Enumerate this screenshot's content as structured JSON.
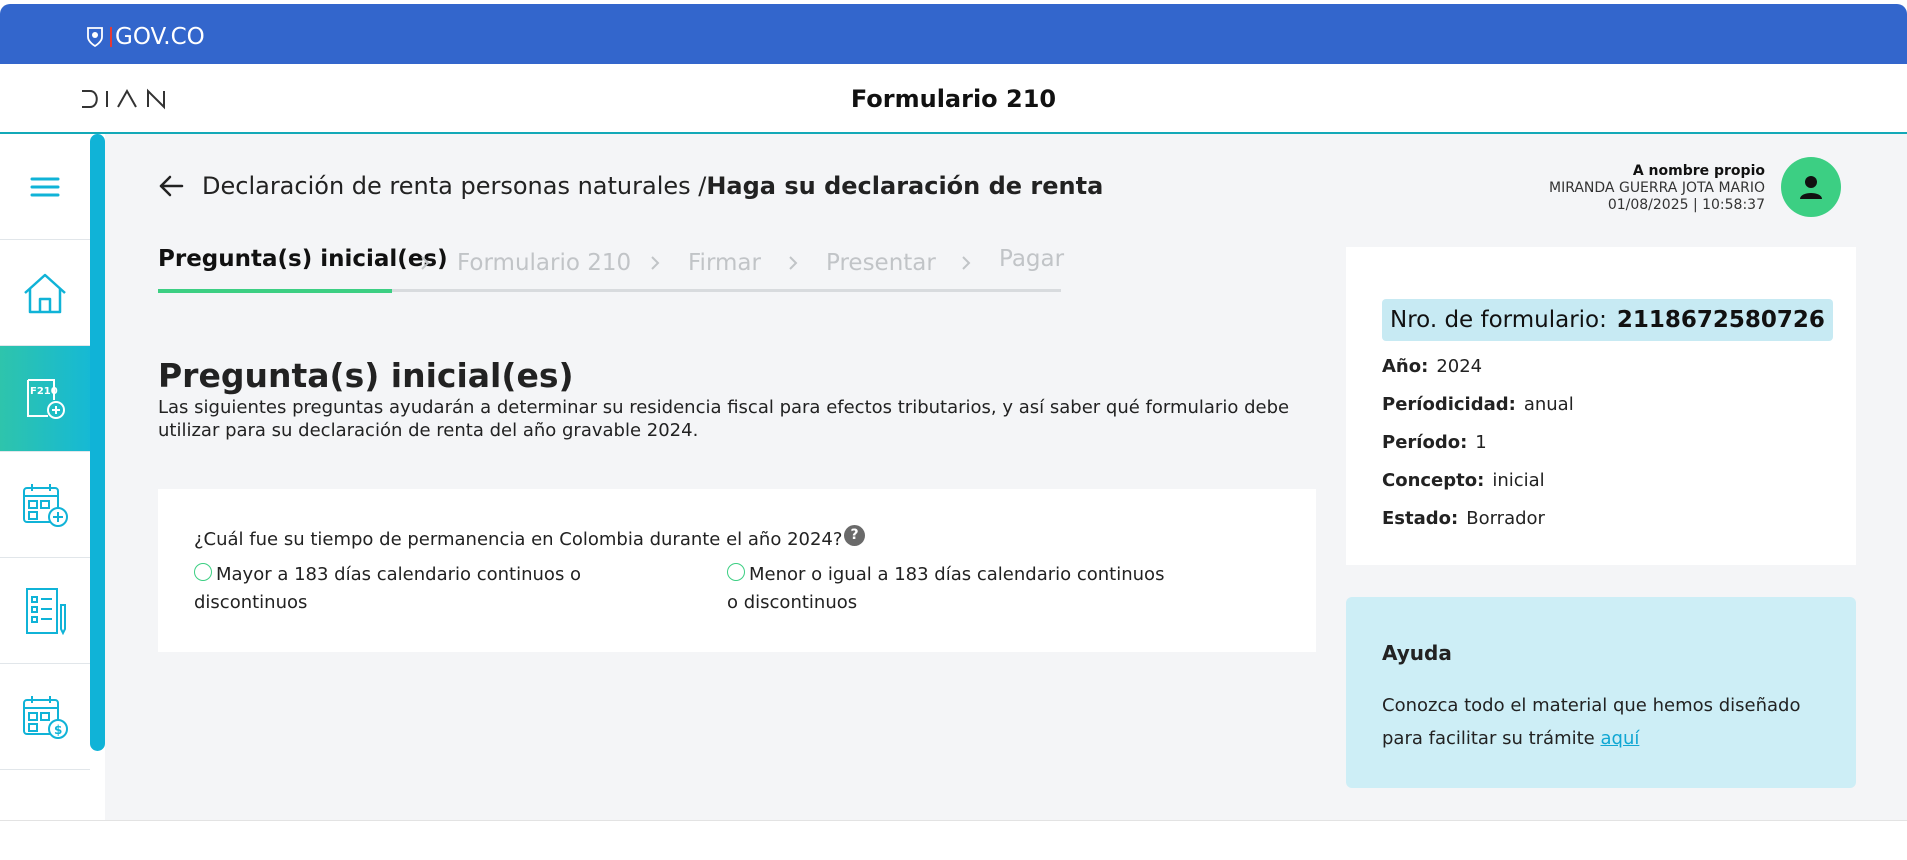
{
  "gov": {
    "label": "GOV.CO"
  },
  "header": {
    "logo_text": "DIAN",
    "title": "Formulario 210"
  },
  "sidebar": {
    "items": [
      {
        "icon": "menu-icon"
      },
      {
        "icon": "home-icon"
      },
      {
        "icon": "form-f210-add-icon",
        "icon_text": "F210",
        "active": true
      },
      {
        "icon": "calendar-add-icon"
      },
      {
        "icon": "checklist-icon"
      },
      {
        "icon": "calendar-payment-icon"
      }
    ],
    "colors": {
      "accent": "#10b3d7",
      "active_from": "#2ec4ac",
      "active_to": "#16b9d4"
    }
  },
  "breadcrumb": {
    "parent": "Declaración de renta personas naturales / ",
    "current": "Haga su declaración de renta"
  },
  "user": {
    "mode": "A nombre propio",
    "name": "MIRANDA GUERRA JOTA MARIO",
    "datetime": "01/08/2025 | 10:58:37"
  },
  "steps": [
    {
      "label": "Pregunta(s) inicial(es)",
      "active": true
    },
    {
      "label": "Formulario 210",
      "active": false
    },
    {
      "label": "Firmar",
      "active": false
    },
    {
      "label": "Presentar",
      "active": false
    },
    {
      "label": "Pagar",
      "active": false
    }
  ],
  "page": {
    "title": "Pregunta(s) inicial(es)",
    "description": "Las siguientes preguntas ayudarán a determinar su residencia fiscal para efectos tributarios, y así saber qué formulario debe utilizar para su declaración de renta del año gravable 2024."
  },
  "question": {
    "text": "¿Cuál fue su tiempo de permanencia en Colombia durante el año 2024?",
    "help": "?",
    "options": [
      "Mayor a 183 días calendario continuos o discontinuos",
      "Menor o igual a 183 días calendario continuos o discontinuos"
    ]
  },
  "info": {
    "form_label": "Nro. de formulario:",
    "form_number": "2118672580726",
    "rows": [
      {
        "key": "Año:",
        "value": "2024"
      },
      {
        "key": "Períodicidad:",
        "value": "anual"
      },
      {
        "key": "Período:",
        "value": "1"
      },
      {
        "key": "Concepto:",
        "value": "inicial"
      },
      {
        "key": "Estado:",
        "value": "Borrador"
      }
    ]
  },
  "help": {
    "title": "Ayuda",
    "text": "Conozca todo el material que hemos diseñado para facilitar su trámite ",
    "link": "aquí"
  },
  "colors": {
    "gov_blue": "#3366CC",
    "success": "#3ccf83",
    "highlight": "#c7eaf3",
    "help_bg": "#cdeef6"
  }
}
